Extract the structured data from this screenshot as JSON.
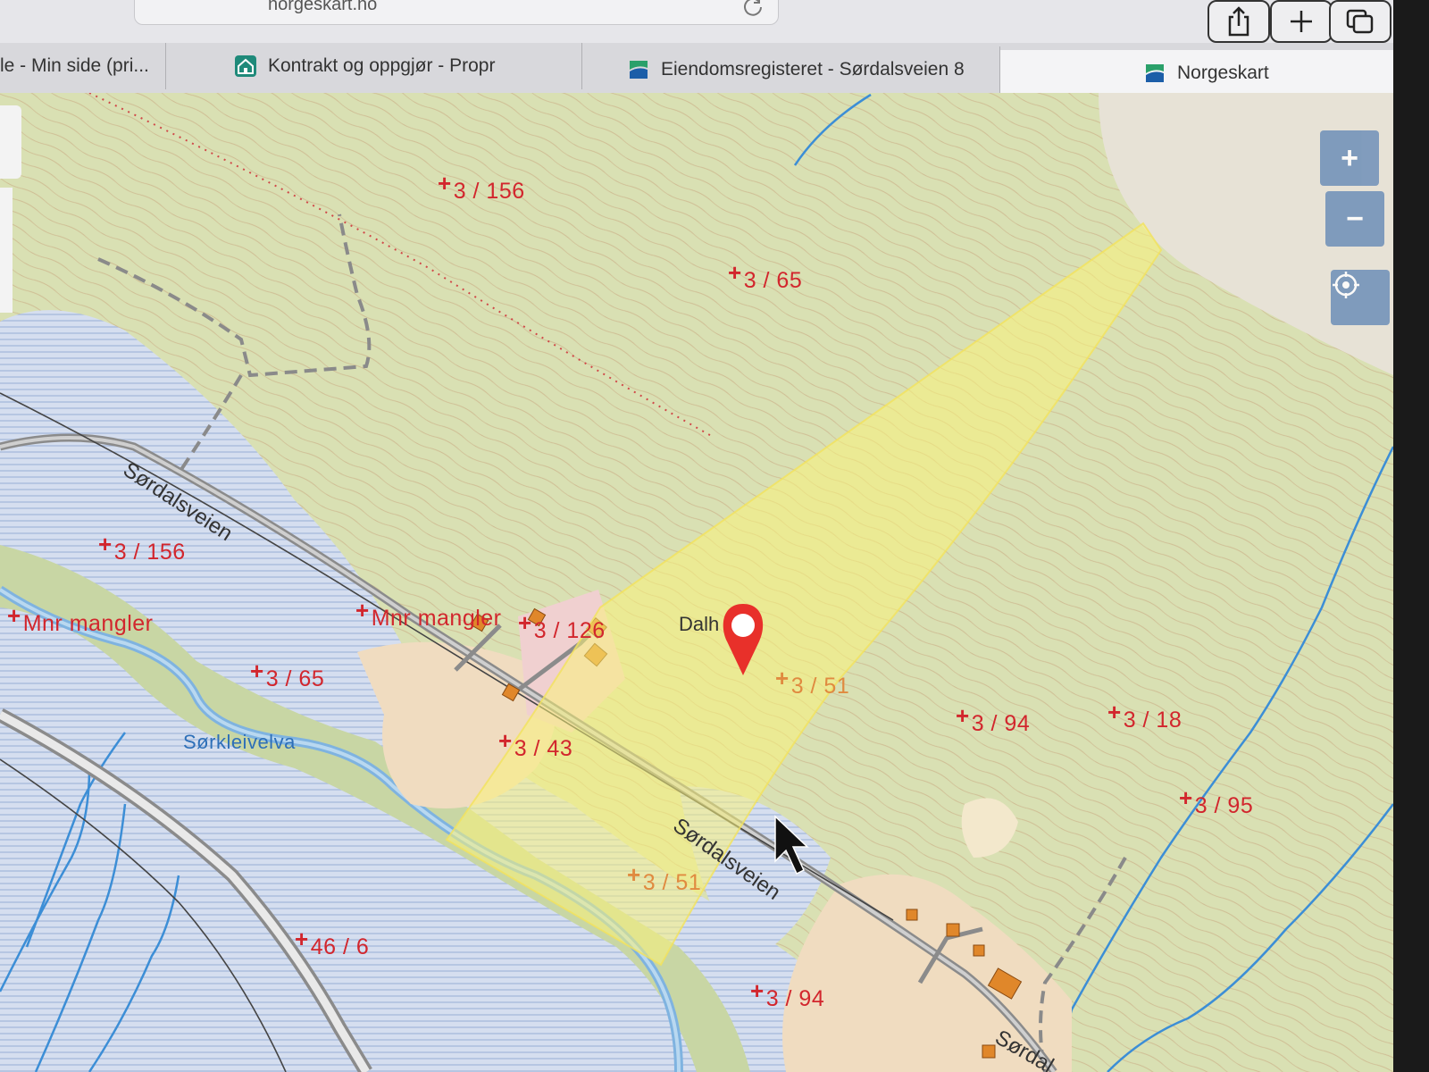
{
  "browser": {
    "url": "norgeskart.no",
    "tabs": [
      {
        "label": "le - Min side (pri..."
      },
      {
        "label": "Kontrakt og oppgjør - Propr"
      },
      {
        "label": "Eiendomsregisteret - Sørdalsveien 8"
      },
      {
        "label": "Norgeskart"
      }
    ],
    "icons": [
      "share-icon",
      "new-tab-icon",
      "tabs-overview-icon",
      "reload-icon"
    ]
  },
  "map": {
    "controls": {
      "zoom_in": "+",
      "zoom_out": "−"
    },
    "parcels": [
      {
        "text": "3 / 156"
      },
      {
        "text": "3 / 65"
      },
      {
        "text": "3 / 156"
      },
      {
        "text": "Mnr mangler"
      },
      {
        "text": "Mnr mangler"
      },
      {
        "text": "3 / 126"
      },
      {
        "text": "3 / 65"
      },
      {
        "text": "3 / 43"
      },
      {
        "text": "3 / 51"
      },
      {
        "text": "3 / 94"
      },
      {
        "text": "3 / 18"
      },
      {
        "text": "3 / 95"
      },
      {
        "text": "3 / 51"
      },
      {
        "text": "46 / 6"
      },
      {
        "text": "3 / 94"
      }
    ],
    "roads": [
      "Sørdalsveien",
      "Sørdalsveien",
      "Sørdal"
    ],
    "river": "Sørkleivelva",
    "place_partial": "Dalh",
    "colors": {
      "terrain": "#d7dfb0",
      "water": "#c6d3e9",
      "highlight": "#f7ef8a",
      "parcel_label": "#d2262d",
      "marker": "#e8302a"
    }
  }
}
